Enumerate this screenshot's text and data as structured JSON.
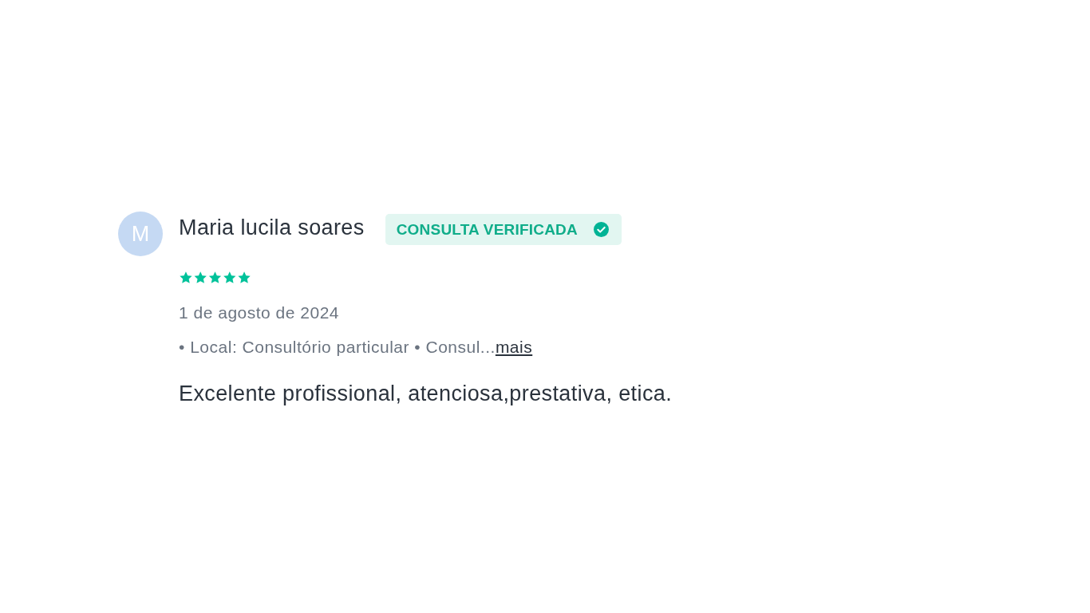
{
  "review": {
    "avatar": {
      "initial": "M"
    },
    "author": "Maria lucila soares",
    "badge": {
      "label": "CONSULTA VERIFICADA"
    },
    "stars": 5,
    "date": "1 de agosto de 2024",
    "details": {
      "text": "• Local: Consultório particular • Consul...",
      "link": "mais"
    },
    "comment": "Excelente profissional, atenciosa,prestativa, etica."
  }
}
